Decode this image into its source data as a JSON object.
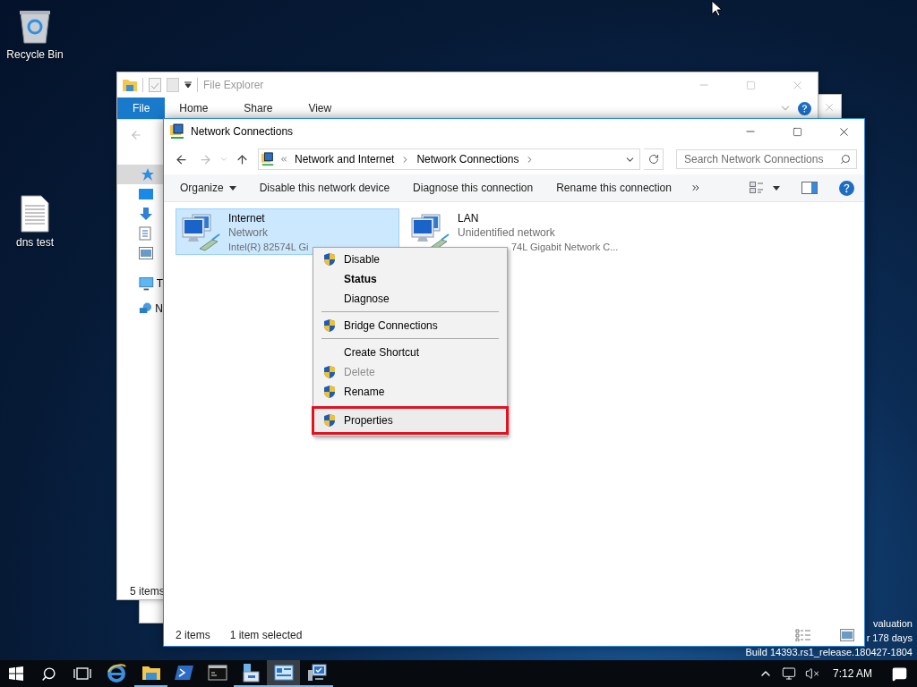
{
  "desktop": {
    "icons": [
      {
        "kind": "recycle-bin",
        "label": "Recycle Bin"
      },
      {
        "kind": "text-file",
        "label": "dns test"
      }
    ],
    "edition_lines": [
      "valuation",
      "r 178 days",
      "Build 14393.rs1_release.180427-1804"
    ]
  },
  "file_explorer": {
    "title": "File Explorer",
    "ribbon_tabs": [
      {
        "label": "File",
        "selected": true
      },
      {
        "label": "Home",
        "selected": false
      },
      {
        "label": "Share",
        "selected": false
      },
      {
        "label": "View",
        "selected": false
      }
    ],
    "sidebar_items": [
      {
        "kind": "quick-access",
        "selected": true
      },
      {
        "kind": "desktop",
        "selected": false
      },
      {
        "kind": "downloads",
        "selected": false
      },
      {
        "kind": "documents",
        "selected": false
      },
      {
        "kind": "pictures",
        "selected": false
      },
      {
        "kind": "this-pc",
        "label": "T",
        "selected": false
      },
      {
        "kind": "network",
        "label": "N",
        "selected": false
      }
    ],
    "status": "5 items"
  },
  "network_connections": {
    "title": "Network Connections",
    "breadcrumb": [
      "Network and Internet",
      "Network Connections"
    ],
    "search": {
      "placeholder": "Search Network Connections"
    },
    "commands": [
      "Organize",
      "Disable this network device",
      "Diagnose this connection",
      "Rename this connection"
    ],
    "connections": [
      {
        "name": "Internet",
        "status": "Network",
        "device": "Intel(R) 82574L Gi",
        "selected": true
      },
      {
        "name": "LAN",
        "status": "Unidentified network",
        "device": "74L Gigabit Network C...",
        "selected": false
      }
    ],
    "status_items": [
      "2 items",
      "1 item selected"
    ]
  },
  "context_menu": {
    "groups": [
      [
        {
          "label": "Disable",
          "shield": true,
          "default": false,
          "disabled": false,
          "highlighted": false
        },
        {
          "label": "Status",
          "shield": false,
          "default": true,
          "disabled": false,
          "highlighted": false
        },
        {
          "label": "Diagnose",
          "shield": false,
          "default": false,
          "disabled": false,
          "highlighted": false
        }
      ],
      [
        {
          "label": "Bridge Connections",
          "shield": true,
          "default": false,
          "disabled": false,
          "highlighted": false
        }
      ],
      [
        {
          "label": "Create Shortcut",
          "shield": false,
          "default": false,
          "disabled": false,
          "highlighted": false
        },
        {
          "label": "Delete",
          "shield": true,
          "default": false,
          "disabled": true,
          "highlighted": false
        },
        {
          "label": "Rename",
          "shield": true,
          "default": false,
          "disabled": false,
          "highlighted": false
        },
        {
          "label": "Properties",
          "shield": true,
          "default": false,
          "disabled": false,
          "highlighted": true
        }
      ]
    ]
  },
  "taskbar": {
    "apps": [
      {
        "kind": "browser",
        "running": false,
        "selected": false
      },
      {
        "kind": "folder",
        "running": true,
        "selected": false
      },
      {
        "kind": "powershell",
        "running": false,
        "selected": false
      },
      {
        "kind": "console",
        "running": false,
        "selected": false
      },
      {
        "kind": "server",
        "running": true,
        "selected": false
      },
      {
        "kind": "network-settings",
        "running": true,
        "selected": true
      },
      {
        "kind": "remote-monitor",
        "running": true,
        "selected": false
      }
    ],
    "clock": "7:12 AM"
  }
}
